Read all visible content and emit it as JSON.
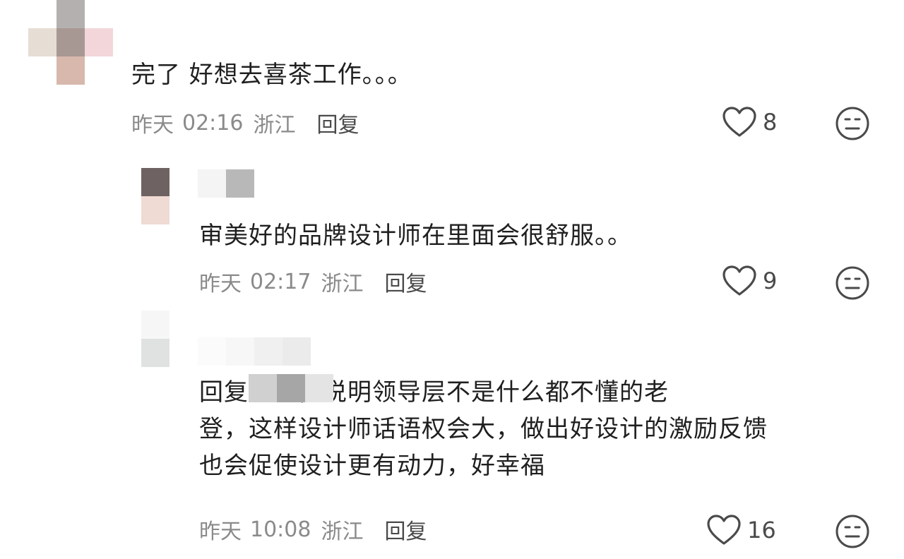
{
  "comments": [
    {
      "text": "完了 好想去喜茶工作。。。",
      "date": "昨天",
      "time": "02:16",
      "location": "浙江",
      "reply_label": "回复",
      "likes": "8"
    },
    {
      "text": "审美好的品牌设计师在里面会很舒服。。",
      "date": "昨天",
      "time": "02:17",
      "location": "浙江",
      "reply_label": "回复",
      "likes": "9"
    },
    {
      "text_prefix": "回复",
      "text_line1_rest": "点了，说明领导层不是什么都不懂的老",
      "text_line2": "登，这样设计师话语权会大，做出好设计的激励反馈",
      "text_line3": "也会促使设计更有动力，好幸福",
      "date": "昨天",
      "time": "10:08",
      "location": "浙江",
      "reply_label": "回复",
      "likes": "16"
    }
  ],
  "icons": {
    "like": "heart-outline-icon",
    "emoji": "neutral-face-icon"
  },
  "colors": {
    "text": "#1f1f1f",
    "meta": "#8a8a8a",
    "reply": "#4a4a4a",
    "icon": "#4a4a4a"
  }
}
